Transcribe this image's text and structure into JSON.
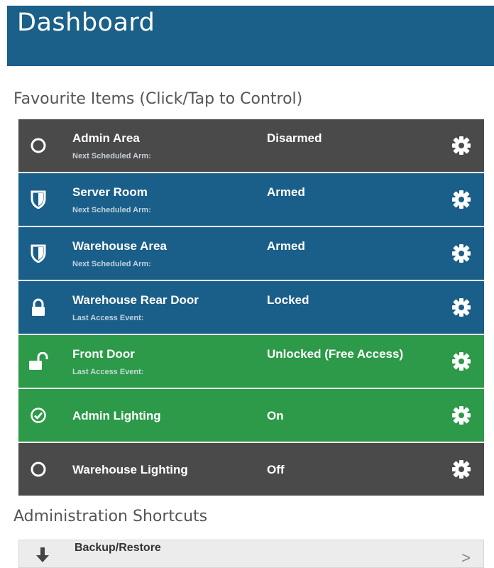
{
  "header": {
    "title": "Dashboard",
    "bg_color": "#1a6089"
  },
  "favourites": {
    "title": "Favourite Items (Click/Tap to Control)",
    "items": [
      {
        "name": "Admin Area",
        "sub": "Next Scheduled Arm:",
        "state": "Disarmed",
        "icon": "circle-icon",
        "color": "#4a4a4a"
      },
      {
        "name": "Server Room",
        "sub": "Next Scheduled Arm:",
        "state": "Armed",
        "icon": "shield-icon",
        "color": "#1a5f89"
      },
      {
        "name": "Warehouse Area",
        "sub": "Next Scheduled Arm:",
        "state": "Armed",
        "icon": "shield-icon",
        "color": "#1a5f89"
      },
      {
        "name": "Warehouse Rear Door",
        "sub": "Last Access Event:",
        "state": "Locked",
        "icon": "lock-icon",
        "color": "#1a5f89"
      },
      {
        "name": "Front Door",
        "sub": "Last Access Event:",
        "state": "Unlocked (Free Access)",
        "icon": "unlock-icon",
        "color": "#2c9a48"
      },
      {
        "name": "Admin Lighting",
        "sub": "",
        "state": "On",
        "icon": "check-circle-icon",
        "color": "#2c9a48"
      },
      {
        "name": "Warehouse Lighting",
        "sub": "",
        "state": "Off",
        "icon": "circle-icon",
        "color": "#4a4a4a"
      }
    ]
  },
  "admin": {
    "title": "Administration Shortcuts",
    "items": [
      {
        "label": "Backup/Restore",
        "icon": "download-icon",
        "chevron": ">"
      }
    ]
  }
}
